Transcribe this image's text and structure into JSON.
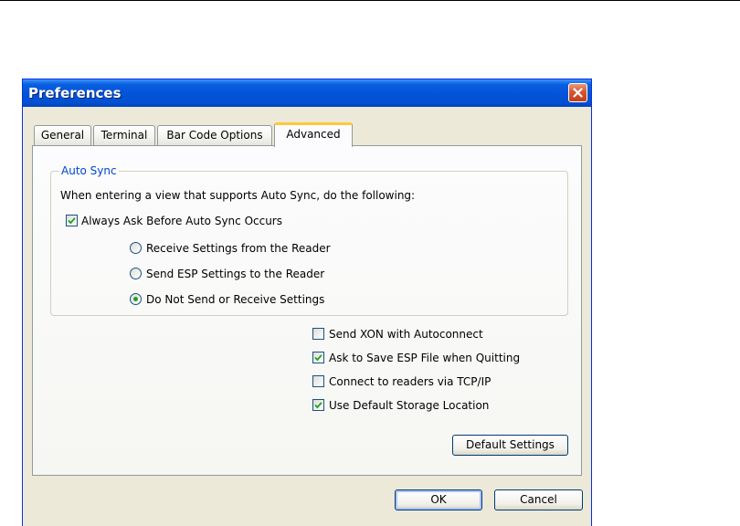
{
  "window": {
    "title": "Preferences"
  },
  "tabs": [
    {
      "label": "General"
    },
    {
      "label": "Terminal"
    },
    {
      "label": "Bar Code Options"
    },
    {
      "label": "Advanced"
    }
  ],
  "active_tab": "Advanced",
  "auto_sync": {
    "group_label": "Auto Sync",
    "description": "When entering a view that supports Auto Sync, do the following:",
    "always_ask": {
      "label": "Always Ask Before Auto Sync Occurs",
      "checked": true
    },
    "options": [
      {
        "label": "Receive Settings from the Reader",
        "selected": false
      },
      {
        "label": "Send ESP Settings to the Reader",
        "selected": false
      },
      {
        "label": "Do Not Send or Receive Settings",
        "selected": true
      }
    ]
  },
  "options": [
    {
      "label": "Send XON with Autoconnect",
      "checked": false
    },
    {
      "label": "Ask to Save ESP File when Quitting",
      "checked": true
    },
    {
      "label": "Connect to readers via TCP/IP",
      "checked": false
    },
    {
      "label": "Use Default Storage Location",
      "checked": true
    }
  ],
  "buttons": {
    "default_settings": "Default Settings",
    "ok": "OK",
    "cancel": "Cancel"
  },
  "colors": {
    "titlebar": "#0352d8",
    "dialog_bg": "#ece9d8",
    "group_label": "#0046d5",
    "radio_dot": "#21a121",
    "close_button": "#d8552f",
    "active_tab_accent": "#ffc83c"
  },
  "icons": {
    "close": "close-x-icon",
    "checkmark": "checkmark-icon"
  }
}
